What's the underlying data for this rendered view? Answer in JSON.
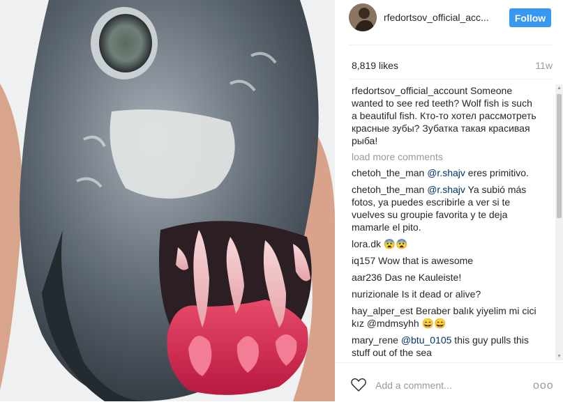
{
  "post": {
    "username": "rfedortsov_official_acc...",
    "follow_label": "Follow",
    "likes": "8,819 likes",
    "time_ago": "11w"
  },
  "comments": [
    {
      "user": "rfedortsov_official_account",
      "mention": "",
      "text": " Someone wanted to see red teeth? Wolf fish is such a beautiful fish. Кто-то хотел рассмотреть красные зубы? Зубатка такая красивая рыба!"
    },
    {
      "user": "chetoh_the_man",
      "mention": "@r.shajv",
      "text": " eres primitivo."
    },
    {
      "user": "chetoh_the_man",
      "mention": "@r.shajv",
      "text": " Ya subió más fotos, ya puedes escribirle a ver si te vuelves su groupie favorita y te deja mamarle el pito."
    },
    {
      "user": "lora.dk",
      "mention": "",
      "text": " 😨😨"
    },
    {
      "user": "iq157",
      "mention": "",
      "text": " Wow that is awesome"
    },
    {
      "user": "aar236",
      "mention": "",
      "text": " Das ne Kauleiste!"
    },
    {
      "user": "nurizionale",
      "mention": "",
      "text": " Is it dead or alive?"
    },
    {
      "user": "hay_alper_est",
      "mention": "",
      "text": " Beraber balık yiyelim mi cici kız @mdmsyhh 😄😄"
    },
    {
      "user": "mary_rene",
      "mention": "@btu_0105",
      "text": " this guy pulls this stuff out of the sea"
    }
  ],
  "load_more": "load more comments",
  "add_comment_placeholder": "Add a comment...",
  "more_options": "ooo",
  "icons": {
    "heart": "heart-icon",
    "scroll_up": "scroll-up-arrow-icon",
    "scroll_down": "scroll-down-arrow-icon"
  }
}
